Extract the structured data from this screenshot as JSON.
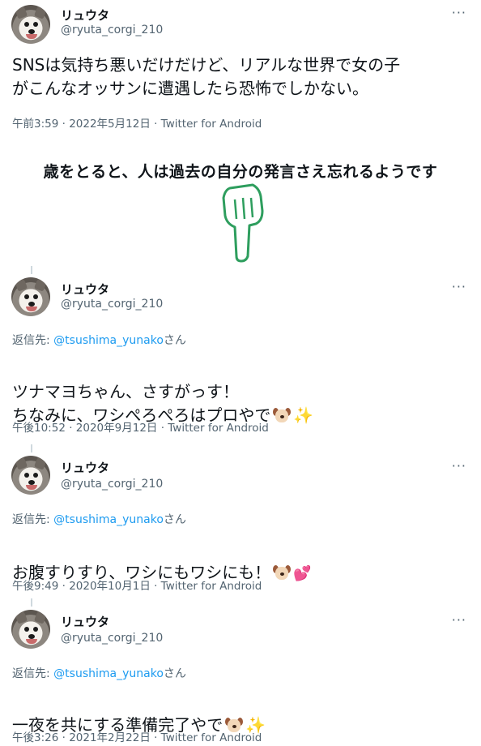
{
  "author": {
    "name": "リュウタ",
    "handle": "@ryuta_corgi_210"
  },
  "more_label": "···",
  "main_tweet": {
    "text": "SNSは気持ち悪いだけだけど、リアルな世界で女の子\nがこんなオッサンに遭遇したら恐怖でしかない。",
    "meta": "午前3:59 · 2022年5月12日 · Twitter for Android"
  },
  "caption": "歳をとると、人は過去の自分の発言さえ忘れるようです",
  "replies": [
    {
      "reply_prefix": "返信先: ",
      "mention": "@tsushima_yunako",
      "reply_suffix": "さん",
      "text": "ツナマヨちゃん、さすがっす！\nちなみに、ワシぺろぺろはプロやで",
      "emojis": [
        "dog-face",
        "sparkles"
      ],
      "meta": "午後10:52 · 2020年9月12日 · Twitter for Android"
    },
    {
      "reply_prefix": "返信先: ",
      "mention": "@tsushima_yunako",
      "reply_suffix": "さん",
      "text": "お腹すりすり、ワシにもワシにも！",
      "emojis": [
        "dog-face",
        "two-hearts"
      ],
      "meta": "午後9:49 · 2020年10月1日 · Twitter for Android"
    },
    {
      "reply_prefix": "返信先: ",
      "mention": "@tsushima_yunako",
      "reply_suffix": "さん",
      "text": "一夜を共にする準備完了やで",
      "emojis": [
        "dog-face",
        "sparkles"
      ],
      "meta": "午後3:26 · 2021年2月22日 · Twitter for Android"
    }
  ],
  "colors": {
    "link": "#1d9bf0",
    "secondary": "#536471",
    "hand": "#2e9e5e"
  }
}
